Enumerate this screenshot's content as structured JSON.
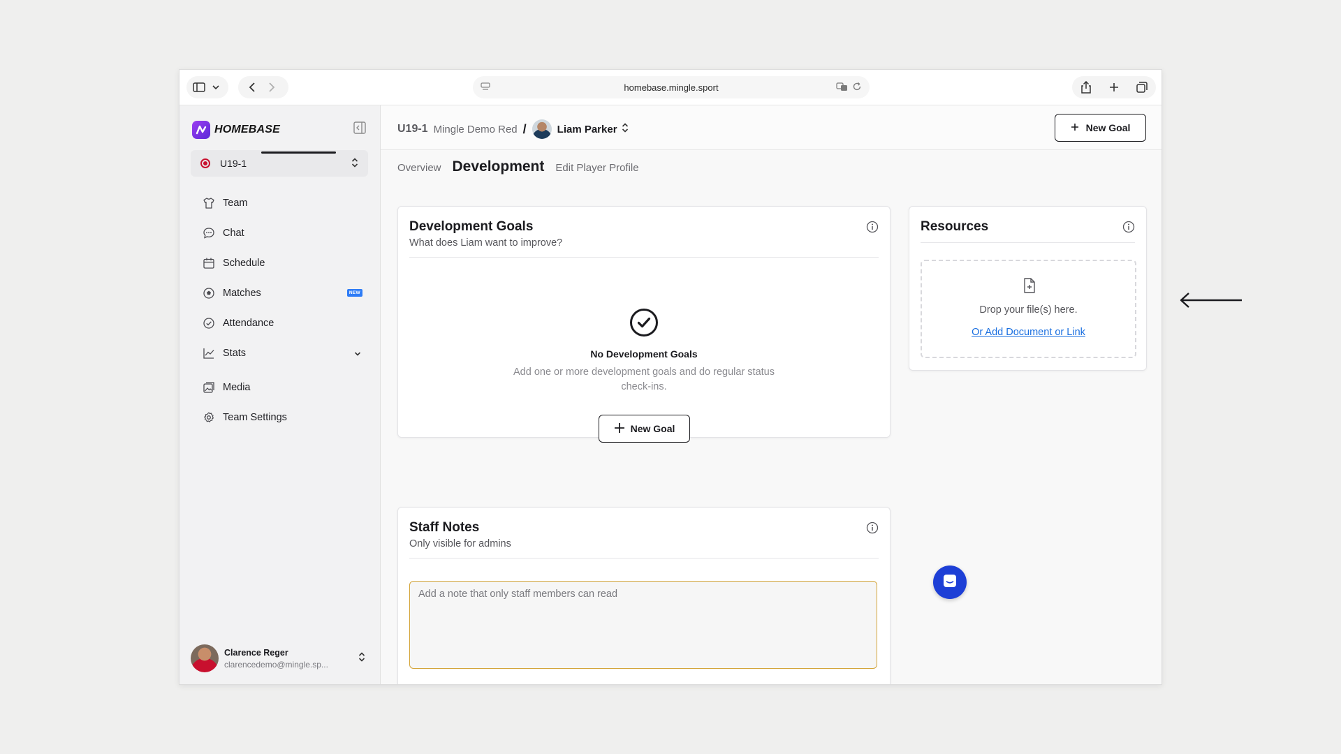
{
  "browser": {
    "url": "homebase.mingle.sport"
  },
  "sidebar": {
    "brand": "HOMEBASE",
    "team_select": "U19-1",
    "items": [
      {
        "label": "Team",
        "icon": "shirt-icon"
      },
      {
        "label": "Chat",
        "icon": "chat-bubble-icon"
      },
      {
        "label": "Schedule",
        "icon": "calendar-icon"
      },
      {
        "label": "Matches",
        "icon": "soccer-ball-icon",
        "badge": "NEW"
      },
      {
        "label": "Attendance",
        "icon": "check-circle-icon"
      },
      {
        "label": "Stats",
        "icon": "line-chart-icon"
      },
      {
        "label": "Media",
        "icon": "images-icon"
      },
      {
        "label": "Team Settings",
        "icon": "gear-icon"
      }
    ],
    "user": {
      "name": "Clarence Reger",
      "email": "clarencedemo@mingle.sp..."
    }
  },
  "header": {
    "team": "U19-1",
    "subteam": "Mingle Demo Red",
    "separator": "/",
    "player": "Liam Parker",
    "new_goal_label": "New Goal"
  },
  "tabs": [
    {
      "label": "Overview",
      "active": false
    },
    {
      "label": "Development",
      "active": true
    },
    {
      "label": "Edit Player Profile",
      "active": false
    }
  ],
  "goals_card": {
    "title": "Development Goals",
    "subtitle": "What does Liam want to improve?",
    "empty_title": "No Development Goals",
    "empty_desc": "Add one or more development goals and do regular status check-ins.",
    "button_label": "New Goal"
  },
  "resources_card": {
    "title": "Resources",
    "drop_text": "Drop your file(s) here.",
    "link_text": "Or Add Document or Link"
  },
  "notes_card": {
    "title": "Staff Notes",
    "subtitle": "Only visible for admins",
    "placeholder": "Add a note that only staff members can read"
  },
  "colors": {
    "brand_gradient_start": "#9b3cf0",
    "brand_gradient_end": "#5b2ad8",
    "link": "#1a6fe0",
    "new_badge": "#2e7cf6",
    "notes_border": "#d4a53a",
    "chat_fab": "#1d3fd6"
  }
}
